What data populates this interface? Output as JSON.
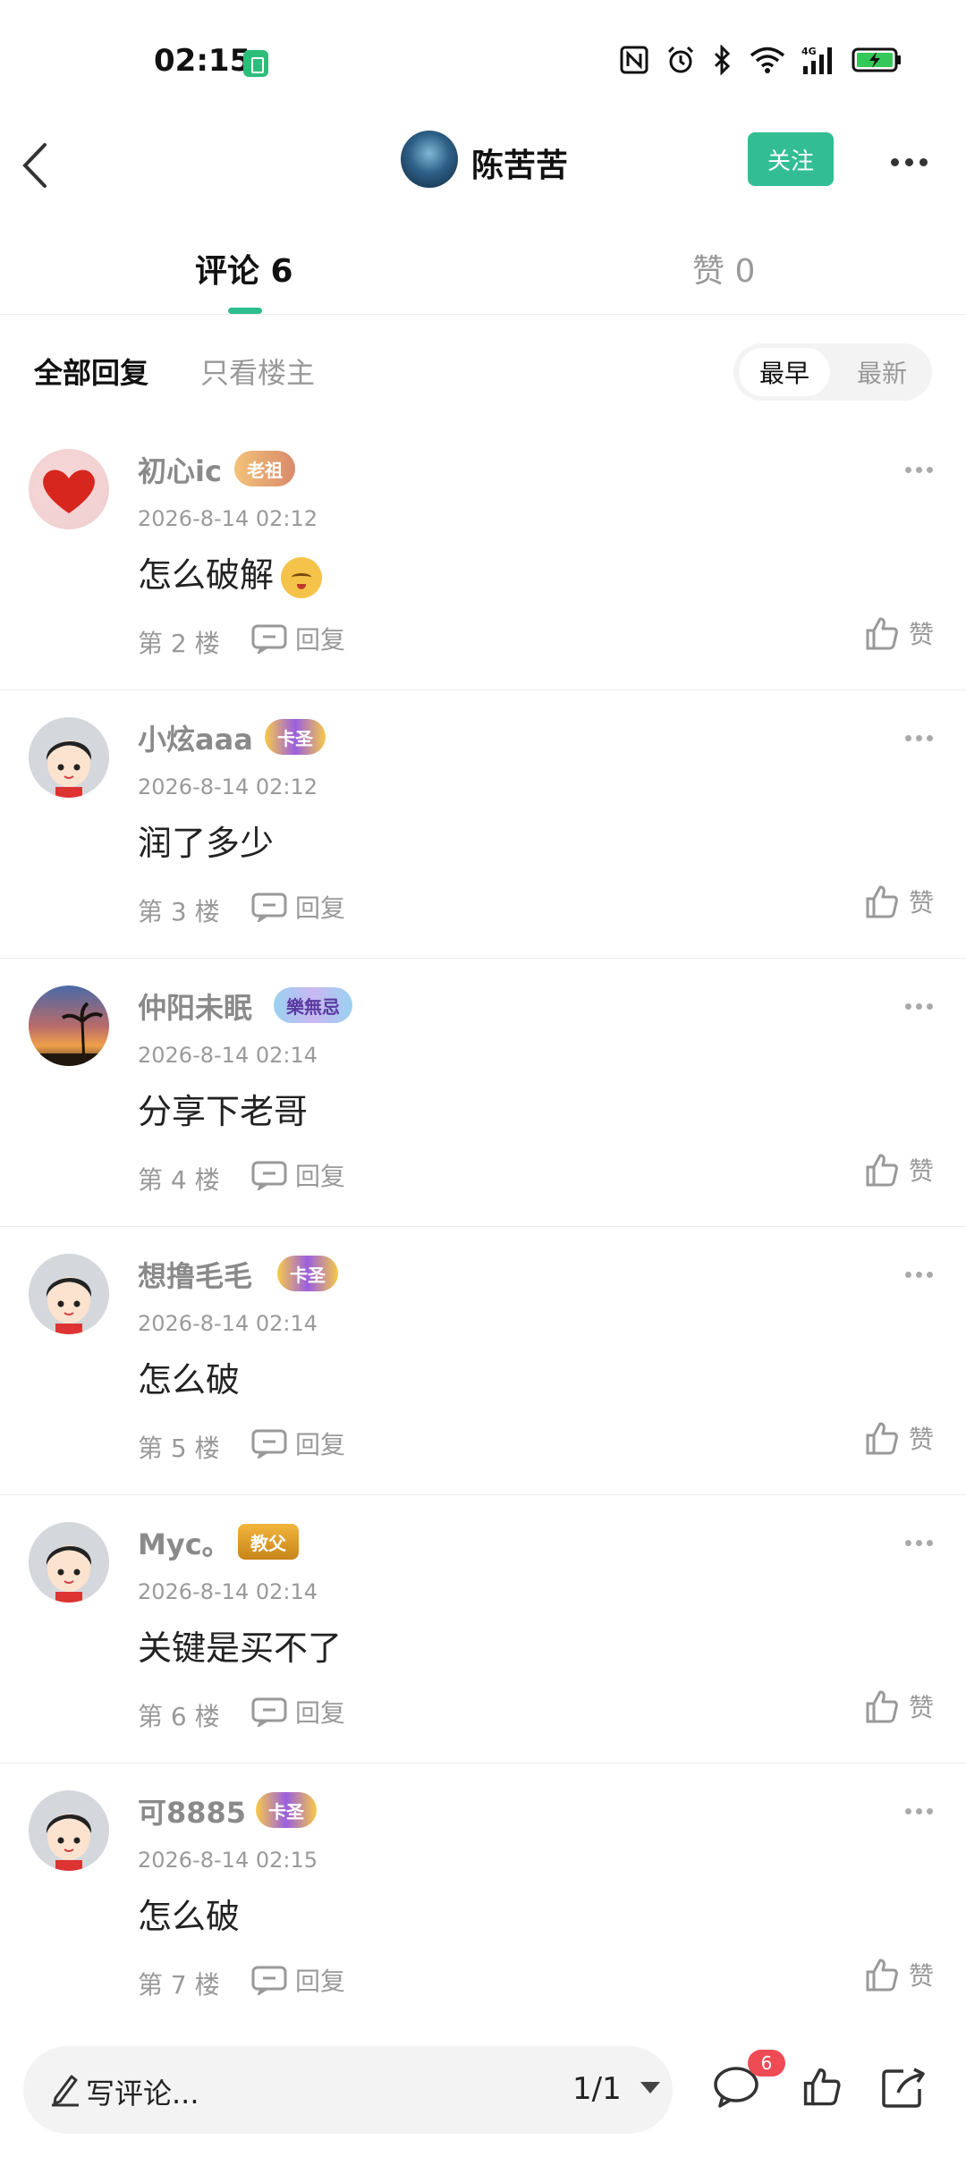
{
  "status_bar": {
    "time": "02:15",
    "icons": [
      "nfc-icon",
      "alarm-icon",
      "bluetooth-icon",
      "wifi-icon",
      "signal-4g-icon",
      "battery-charging-icon"
    ]
  },
  "header": {
    "author_name": "陈苦苦",
    "follow_label": "关注"
  },
  "tabs": {
    "comments_label": "评论 6",
    "likes_label": "赞 0"
  },
  "filter": {
    "all_replies": "全部回复",
    "op_only": "只看楼主",
    "sort_earliest": "最早",
    "sort_latest": "最新"
  },
  "comments": [
    {
      "name": "初心ic",
      "badge": "老祖",
      "time": "2026-8-14 02:12",
      "text": "怎么破解",
      "emoji": "pleading-face",
      "floor": "第 2 楼",
      "reply": "回复",
      "like": "赞",
      "avatar": "heart"
    },
    {
      "name": "小炫aaa",
      "badge": "卡圣",
      "time": "2026-8-14 02:12",
      "text": "润了多少",
      "floor": "第 3 楼",
      "reply": "回复",
      "like": "赞",
      "avatar": "default"
    },
    {
      "name": "仲阳未眠",
      "badge": "樂無忌",
      "time": "2026-8-14 02:14",
      "text": "分享下老哥",
      "floor": "第 4 楼",
      "reply": "回复",
      "like": "赞",
      "avatar": "sunset"
    },
    {
      "name": "想撸毛毛",
      "badge": "卡圣",
      "time": "2026-8-14 02:14",
      "text": "怎么破",
      "floor": "第 5 楼",
      "reply": "回复",
      "like": "赞",
      "avatar": "default"
    },
    {
      "name": "Myc。",
      "badge": "教父",
      "time": "2026-8-14 02:14",
      "text": "关键是买不了",
      "floor": "第 6 楼",
      "reply": "回复",
      "like": "赞",
      "avatar": "default"
    },
    {
      "name": "可8885",
      "badge": "卡圣",
      "time": "2026-8-14 02:15",
      "text": "怎么破",
      "floor": "第 7 楼",
      "reply": "回复",
      "like": "赞",
      "avatar": "default"
    }
  ],
  "bottom_bar": {
    "input_placeholder": "写评论...",
    "page_indicator": "1/1",
    "message_count": "6"
  },
  "colors": {
    "accent": "#33bd95",
    "badge_red": "#ee4b55"
  }
}
